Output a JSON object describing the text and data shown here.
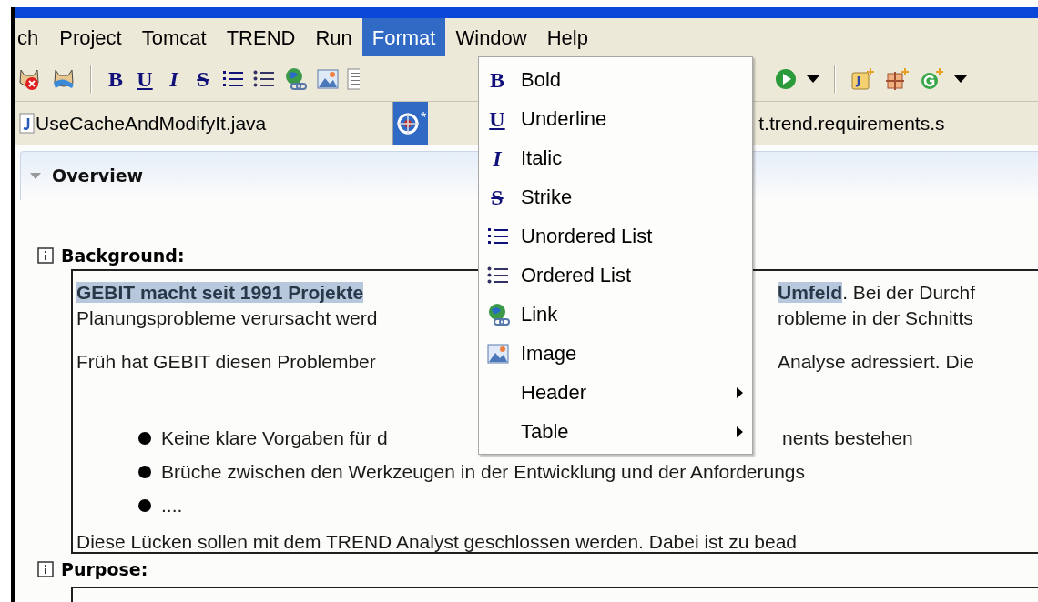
{
  "menubar": [
    {
      "label": "ch",
      "selected": false
    },
    {
      "label": "Project",
      "selected": false
    },
    {
      "label": "Tomcat",
      "selected": false
    },
    {
      "label": "TREND",
      "selected": false
    },
    {
      "label": "Run",
      "selected": false
    },
    {
      "label": "Format",
      "selected": true
    },
    {
      "label": "Window",
      "selected": false
    },
    {
      "label": "Help",
      "selected": false
    }
  ],
  "toolbar_left": [
    {
      "kind": "cat-x"
    },
    {
      "kind": "cat"
    },
    {
      "kind": "sep"
    },
    {
      "kind": "bold",
      "glyph": "B"
    },
    {
      "kind": "underline",
      "glyph": "U"
    },
    {
      "kind": "italic",
      "glyph": "I"
    },
    {
      "kind": "strike",
      "glyph": "S"
    },
    {
      "kind": "ul"
    },
    {
      "kind": "ol"
    },
    {
      "kind": "link"
    },
    {
      "kind": "image"
    },
    {
      "kind": "doc"
    }
  ],
  "toolbar_right": [
    {
      "kind": "run"
    },
    {
      "kind": "caret"
    },
    {
      "kind": "sep"
    },
    {
      "kind": "jplus"
    },
    {
      "kind": "gridplus"
    },
    {
      "kind": "gplus"
    },
    {
      "kind": "caret"
    }
  ],
  "tabs": [
    {
      "kind": "java",
      "label": "UseCacheAndModifyIt.java",
      "selected": false
    },
    {
      "kind": "trend",
      "label": "*",
      "label_end": "t.trend.requirements.s",
      "selected": true
    }
  ],
  "overview": {
    "title": "Overview",
    "expanded": true
  },
  "background": {
    "label": "Background:",
    "lines": [
      {
        "kind": "para",
        "left": [
          {
            "text": "GEBIT macht seit 1991 Projekte",
            "bold": true,
            "highlighted": true
          }
        ],
        "right": [
          {
            "text": "Umfeld",
            "bold": true,
            "highlighted": true
          },
          {
            "text": ". Bei der Durchf",
            "bold": false,
            "highlighted": false
          }
        ]
      },
      {
        "kind": "para",
        "left": [
          {
            "text": "Planungsprobleme verursacht werd",
            "bold": false,
            "highlighted": false
          }
        ],
        "right": [
          {
            "text": "robleme in der Schnitts",
            "bold": false,
            "highlighted": false
          }
        ]
      },
      {
        "kind": "blank"
      },
      {
        "kind": "para",
        "left": [
          {
            "text": "Früh hat GEBIT diesen Problember",
            "bold": false,
            "highlighted": false
          }
        ],
        "right": [
          {
            "text": "Analyse adressiert. Die",
            "bold": false,
            "highlighted": false
          }
        ]
      },
      {
        "kind": "blank"
      },
      {
        "kind": "bullet",
        "left": [
          {
            "text": "Keine klare Vorgaben für d",
            "bold": false,
            "highlighted": false
          }
        ],
        "right": [
          {
            "text": "nents bestehen",
            "bold": false,
            "highlighted": false
          }
        ]
      },
      {
        "kind": "bullet",
        "left": [
          {
            "text": "Brüche zwischen den Werkzeugen in der Entwicklung und der Anforderungs",
            "bold": false,
            "highlighted": false
          }
        ]
      },
      {
        "kind": "bullet",
        "left": [
          {
            "text": "....",
            "bold": false,
            "highlighted": false
          }
        ]
      },
      {
        "kind": "para",
        "left": [
          {
            "text": "Diese Lücken sollen mit dem TREND Analyst geschlossen werden. Dabei ist zu bead",
            "bold": false,
            "highlighted": false
          }
        ]
      }
    ]
  },
  "purpose": {
    "label": "Purpose:"
  },
  "format_menu": [
    {
      "kind": "bold",
      "glyph": "B",
      "label": "Bold",
      "submenu": false
    },
    {
      "kind": "underline",
      "glyph": "U",
      "label": "Underline",
      "submenu": false
    },
    {
      "kind": "italic",
      "glyph": "I",
      "label": "Italic",
      "submenu": false
    },
    {
      "kind": "strike",
      "glyph": "S",
      "label": "Strike",
      "submenu": false
    },
    {
      "kind": "ul",
      "label": "Unordered List",
      "submenu": false
    },
    {
      "kind": "ol",
      "label": "Ordered List",
      "submenu": false
    },
    {
      "kind": "link",
      "label": "Link",
      "submenu": false
    },
    {
      "kind": "image",
      "label": "Image",
      "submenu": false
    },
    {
      "kind": "none",
      "label": "Header",
      "submenu": true
    },
    {
      "kind": "none",
      "label": "Table",
      "submenu": true
    }
  ]
}
